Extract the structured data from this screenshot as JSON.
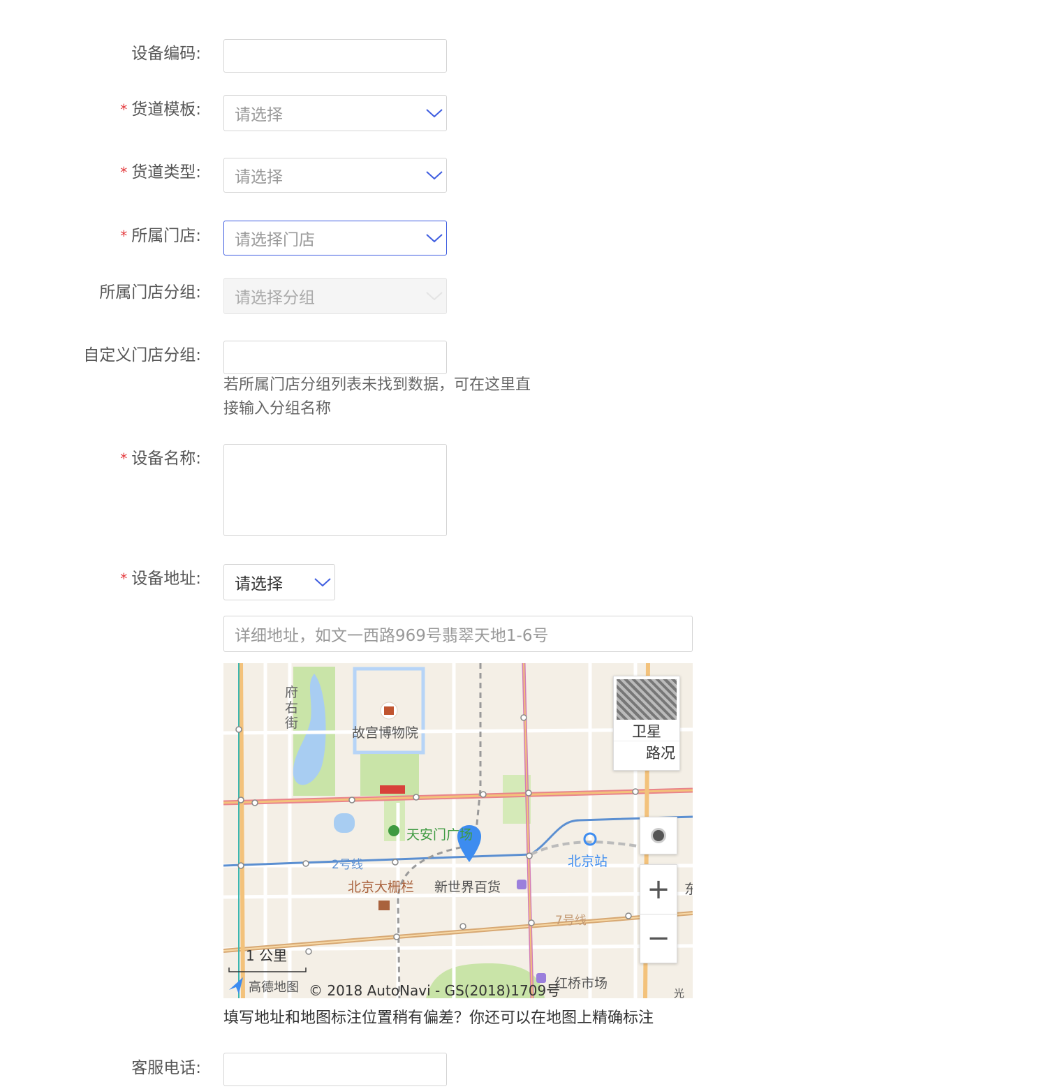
{
  "form": {
    "device_code": {
      "label": "设备编码:",
      "value": ""
    },
    "channel_template": {
      "label": "货道模板:",
      "placeholder": "请选择"
    },
    "channel_type": {
      "label": "货道类型:",
      "placeholder": "请选择"
    },
    "store": {
      "label": "所属门店:",
      "placeholder": "请选择门店"
    },
    "store_group": {
      "label": "所属门店分组:",
      "placeholder": "请选择分组"
    },
    "custom_group": {
      "label": "自定义门店分组:",
      "value": "",
      "hint_line1": "若所属门店分组列表未找到数据，可在这里直",
      "hint_line2": "接输入分组名称"
    },
    "device_name": {
      "label": "设备名称:",
      "value": ""
    },
    "device_address": {
      "label": "设备地址:",
      "region_value": "请选择",
      "detail_placeholder": "详细地址，如文一西路969号翡翠天地1-6号",
      "map_hint": "填写地址和地图标注位置稍有偏差？你还可以在地图上精确标注"
    },
    "service_phone": {
      "label": "客服电话:",
      "value": ""
    },
    "required_mark": "*"
  },
  "map": {
    "places": {
      "palace_museum": "故宫博物院",
      "fuyou_street": [
        "府",
        "右",
        "街"
      ],
      "tiananmen_square": "天安门广场",
      "line2": "2号线",
      "dashilar": "北京大栅栏",
      "new_world": "新世界百货",
      "beijing_station": "北京站",
      "line7": "7号线",
      "hongqiao_market": "红桥市场",
      "east_fragment": "东",
      "bottom_fragment": "光"
    },
    "satellite_label": "卫星",
    "traffic_label": "路况",
    "scale_label": "1 公里",
    "logo_text": "高德地图",
    "copyright": "© 2018 AutoNavi - GS(2018)1709号",
    "zoom_in": "+",
    "zoom_out": "−",
    "colors": {
      "background": "#f4efe6",
      "park": "#c9e4a8",
      "water": "#a8cdf2",
      "main_road": "#f3c27b",
      "red_road": "#e9848a",
      "metro_blue": "#5b8fd1",
      "marker": "#3d8cf0"
    }
  }
}
